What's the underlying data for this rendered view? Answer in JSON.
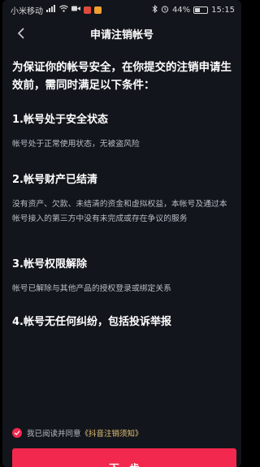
{
  "statusbar": {
    "carrier": "小米移动",
    "battery": "44%",
    "time": "15:15",
    "battery_level": 0.44
  },
  "navbar": {
    "title": "申请注销帐号"
  },
  "intro": "为保证你的帐号安全，在你提交的注销申请生效前，需同时满足以下条件：",
  "conditions": [
    {
      "title": "1.帐号处于安全状态",
      "desc": "帐号处于正常使用状态，无被盗风险"
    },
    {
      "title": "2.帐号财产已结清",
      "desc": "没有资产、欠款、未结清的资金和虚拟权益，本帐号及通过本帐号接入的第三方中没有未完成或存在争议的服务"
    },
    {
      "title": "3.帐号权限解除",
      "desc": "帐号已解除与其他产品的授权登录或绑定关系"
    },
    {
      "title": "4.帐号无任何纠纷，包括投诉举报",
      "desc": ""
    }
  ],
  "agreement": {
    "text": "我已阅读并同意",
    "link": "《抖音注销须知》",
    "checked": true
  },
  "next_button": "下一步",
  "colors": {
    "accent": "#f2284e",
    "link": "#e8c877",
    "background": "#13151c"
  },
  "icons": {
    "back": "chevron-left-icon",
    "bluetooth": "bluetooth-icon",
    "alarm": "alarm-icon",
    "signal": "signal-icon",
    "wifi": "wifi-icon",
    "check": "check-icon"
  }
}
